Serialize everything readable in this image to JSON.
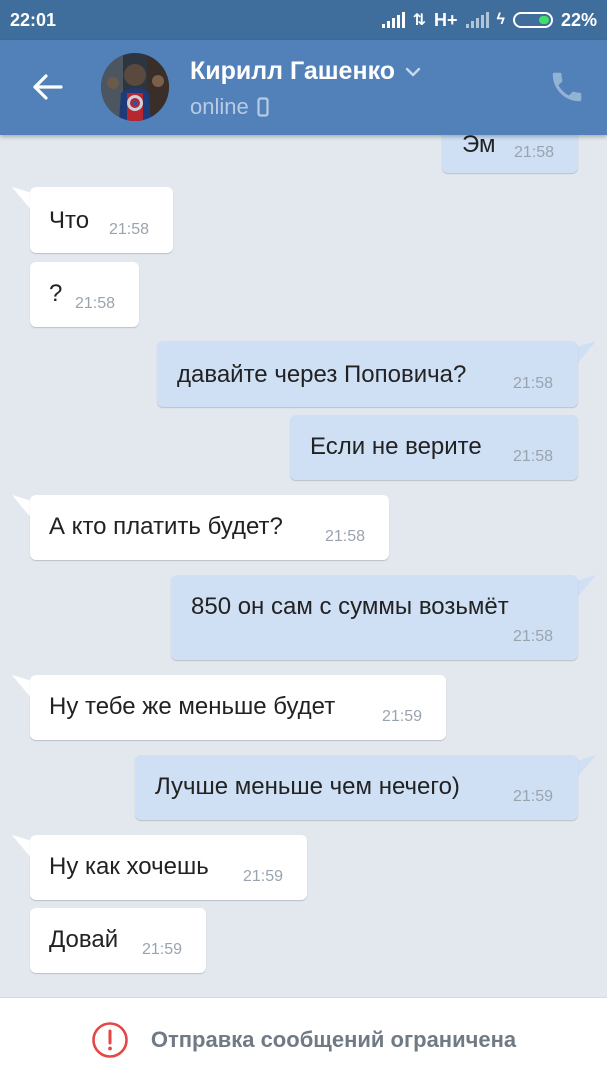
{
  "status_bar": {
    "time": "22:01",
    "network": "H+",
    "battery_percent": "22%",
    "battery_level": 0.22
  },
  "header": {
    "contact_name": "Кирилл Гашенко",
    "status": "online"
  },
  "messages": [
    {
      "direction": "out",
      "text": "Эм",
      "time": "21:58"
    },
    {
      "direction": "in",
      "text": "Что",
      "time": "21:58"
    },
    {
      "direction": "in",
      "text": "?",
      "time": "21:58"
    },
    {
      "direction": "out",
      "text": "давайте через Поповича?",
      "time": "21:58"
    },
    {
      "direction": "out",
      "text": "Если не верите",
      "time": "21:58"
    },
    {
      "direction": "in",
      "text": "А кто платить будет?",
      "time": "21:58"
    },
    {
      "direction": "out",
      "text": "850 он сам с суммы возьмёт",
      "time": "21:58"
    },
    {
      "direction": "in",
      "text": "Ну тебе же меньше будет",
      "time": "21:59"
    },
    {
      "direction": "out",
      "text": "Лучше меньше чем нечего)",
      "time": "21:59"
    },
    {
      "direction": "in",
      "text": "Ну как хочешь",
      "time": "21:59"
    },
    {
      "direction": "in",
      "text": "Довай",
      "time": "21:59"
    }
  ],
  "footer": {
    "notice": "Отправка сообщений ограничена"
  },
  "colors": {
    "header": "#5181b8",
    "status_bar": "#3f6e9c",
    "outgoing_bubble": "#cfe0f5",
    "incoming_bubble": "#ffffff",
    "background": "#e3e8ee",
    "warning": "#e64646"
  },
  "icons": [
    "back-arrow-icon",
    "chevron-down-icon",
    "mobile-icon",
    "phone-icon",
    "warning-icon"
  ]
}
